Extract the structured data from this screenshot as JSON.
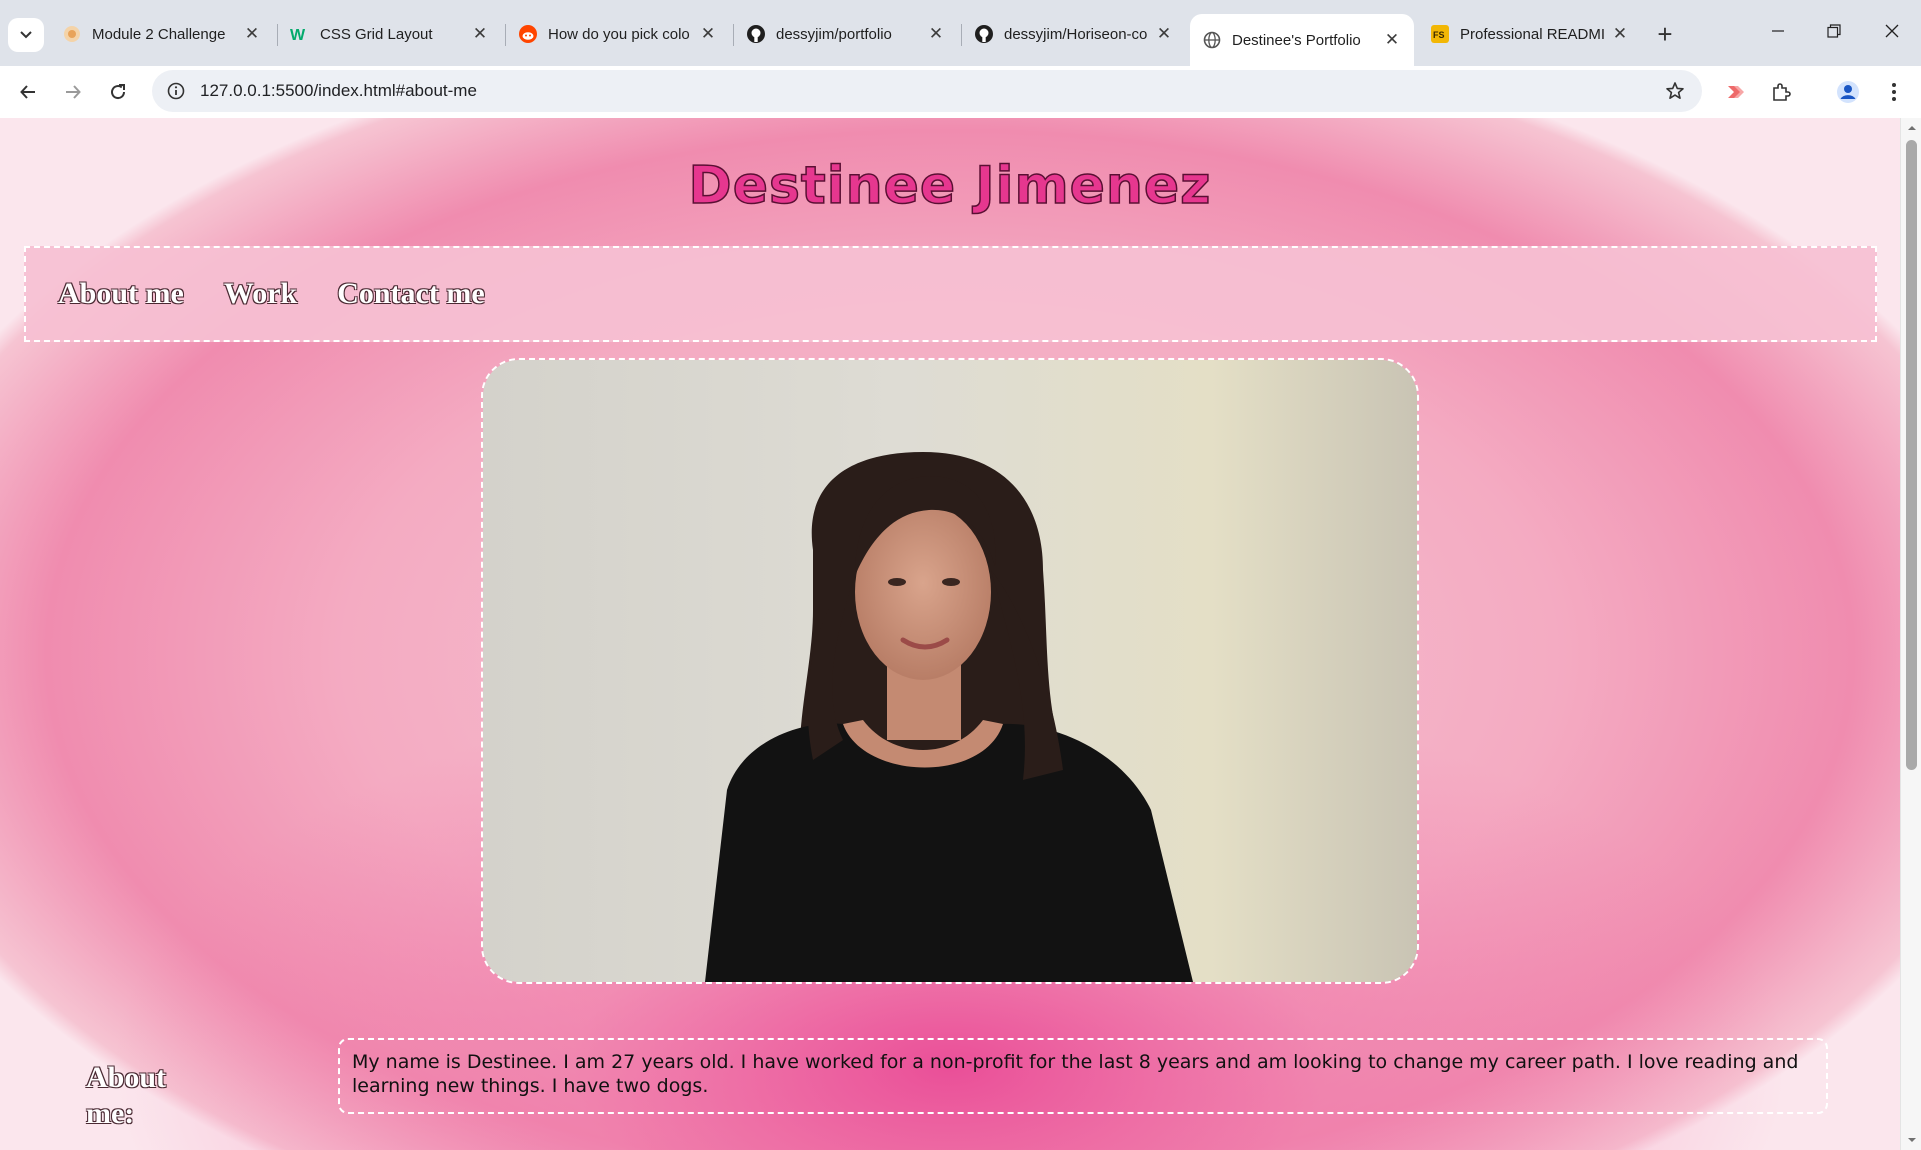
{
  "browser": {
    "tabs": [
      {
        "title": "Module 2 Challenge",
        "icon": "bootcamp-icon",
        "active": false
      },
      {
        "title": "CSS Grid Layout",
        "icon": "w3schools-icon",
        "active": false
      },
      {
        "title": "How do you pick colo",
        "icon": "reddit-icon",
        "active": false
      },
      {
        "title": "dessyjim/portfolio",
        "icon": "github-icon",
        "active": false
      },
      {
        "title": "dessyjim/Horiseon-co",
        "icon": "github-icon",
        "active": false
      },
      {
        "title": "Destinee's Portfolio",
        "icon": "globe-icon",
        "active": true
      },
      {
        "title": "Professional READMI",
        "icon": "fs-icon",
        "active": false
      }
    ],
    "url": "127.0.0.1:5500/index.html#about-me"
  },
  "site": {
    "title": "Destinee Jimenez",
    "nav": [
      "About me",
      "Work",
      "Contact me"
    ],
    "about_heading": "About me:",
    "about_text": "My name is Destinee. I am 27 years old. I have worked for a non-profit for the last 8 years and am looking to change my career path. I love reading and learning new things. I have two dogs."
  },
  "colors": {
    "title": "#e6378f",
    "nav_bg": "#f6c0d3",
    "page_pink": "#f08caf"
  }
}
